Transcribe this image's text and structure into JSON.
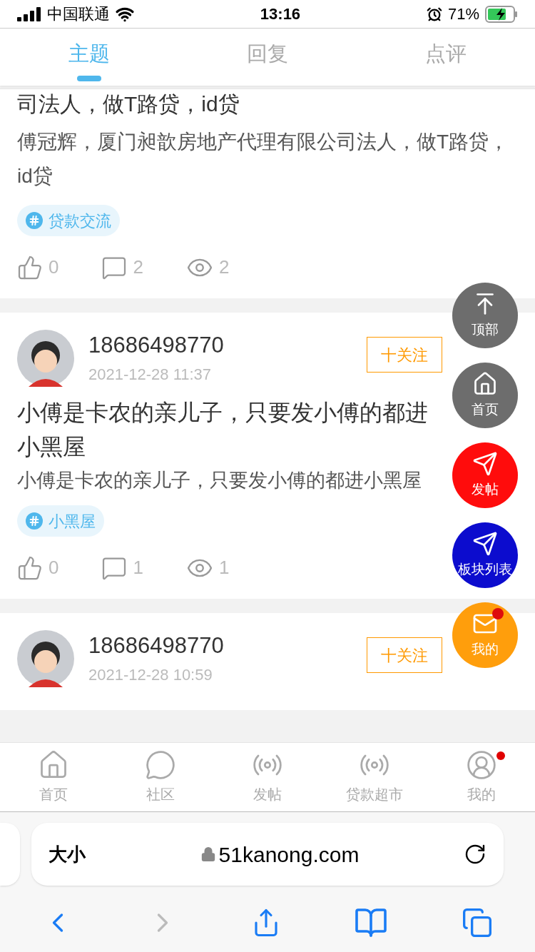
{
  "status_bar": {
    "carrier": "中国联通",
    "time": "13:16",
    "battery": "71%"
  },
  "tabs": [
    {
      "label": "主题",
      "selected": true
    },
    {
      "label": "回复",
      "selected": false
    },
    {
      "label": "点评",
      "selected": false
    }
  ],
  "posts": [
    {
      "kind": "partial",
      "title": "司法人，做T路贷，id贷",
      "body": "傅冠辉，厦门昶歆房地产代理有限公司法人，做T路贷，id贷",
      "tag": "贷款交流",
      "likes": "0",
      "comments": "2",
      "views": "2"
    },
    {
      "kind": "full",
      "user": "18686498770",
      "date": "2021-12-28 11:37",
      "follow": "十关注",
      "title": "小傅是卡农的亲儿子，只要发小傅的都进小黑屋",
      "body": "小傅是卡农的亲儿子，只要发小傅的都进小黑屋",
      "tag": "小黑屋",
      "likes": "0",
      "comments": "1",
      "views": "1"
    },
    {
      "kind": "header",
      "user": "18686498770",
      "date": "2021-12-28 10:59",
      "follow": "十关注"
    }
  ],
  "float_buttons": [
    {
      "kind": "top",
      "label": "顶部",
      "color": "#666666",
      "dot": false
    },
    {
      "kind": "home",
      "label": "首页",
      "color": "#666666",
      "dot": false
    },
    {
      "kind": "send",
      "label": "发帖",
      "color": "#ff0000",
      "dot": false
    },
    {
      "kind": "send",
      "label": "板块列表",
      "color": "#0000cc",
      "dot": false
    },
    {
      "kind": "mail",
      "label": "我的",
      "color": "#ff9900",
      "dot": true
    }
  ],
  "bottom_nav": [
    {
      "kind": "home",
      "label": "首页",
      "dot": false
    },
    {
      "kind": "chat",
      "label": "社区",
      "dot": false
    },
    {
      "kind": "signal",
      "label": "发帖",
      "dot": false
    },
    {
      "kind": "signal",
      "label": "贷款超市",
      "dot": false
    },
    {
      "kind": "user",
      "label": "我的",
      "dot": true
    }
  ],
  "browser": {
    "text_size": "大小",
    "url": "51kanong.com",
    "back_disabled": false,
    "forward_disabled": true
  }
}
